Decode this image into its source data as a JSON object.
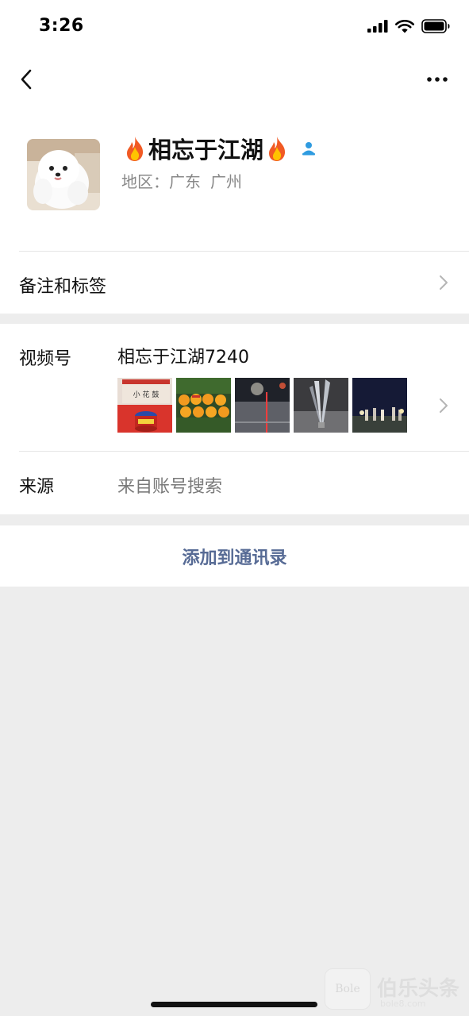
{
  "status_bar": {
    "time": "3:26",
    "icons": [
      "cellular-signal-icon",
      "wifi-icon",
      "battery-icon"
    ]
  },
  "nav": {
    "back_icon": "chevron-left-icon",
    "more_icon": "more-dots-icon"
  },
  "profile": {
    "avatar_icon": "pomeranian-dog-avatar",
    "name": "相忘于江湖",
    "name_decorations": [
      "fire-emoji",
      "fire-emoji"
    ],
    "badge_icon": "friend-person-icon",
    "region_label": "地区：",
    "region_province": "广东",
    "region_city": "广州"
  },
  "rows": {
    "remark_tags_label": "备注和标签",
    "channels_label": "视频号",
    "channels_value": "相忘于江湖7240",
    "source_label": "来源",
    "source_value": "来自账号搜索"
  },
  "channel_thumbnails": [
    "firework-box-photo",
    "oranges-photo",
    "street-fireworks-photo",
    "sparkler-photo",
    "night-crowd-photo"
  ],
  "actions": {
    "add_contact": "添加到通讯录"
  },
  "watermark": {
    "logo": "Bole",
    "text": "伯乐头条",
    "sub": "bole8.com"
  },
  "colors": {
    "link_blue": "#576b95",
    "badge_blue": "#2f9be0",
    "secondary_text": "#888888",
    "background": "#ededed"
  }
}
